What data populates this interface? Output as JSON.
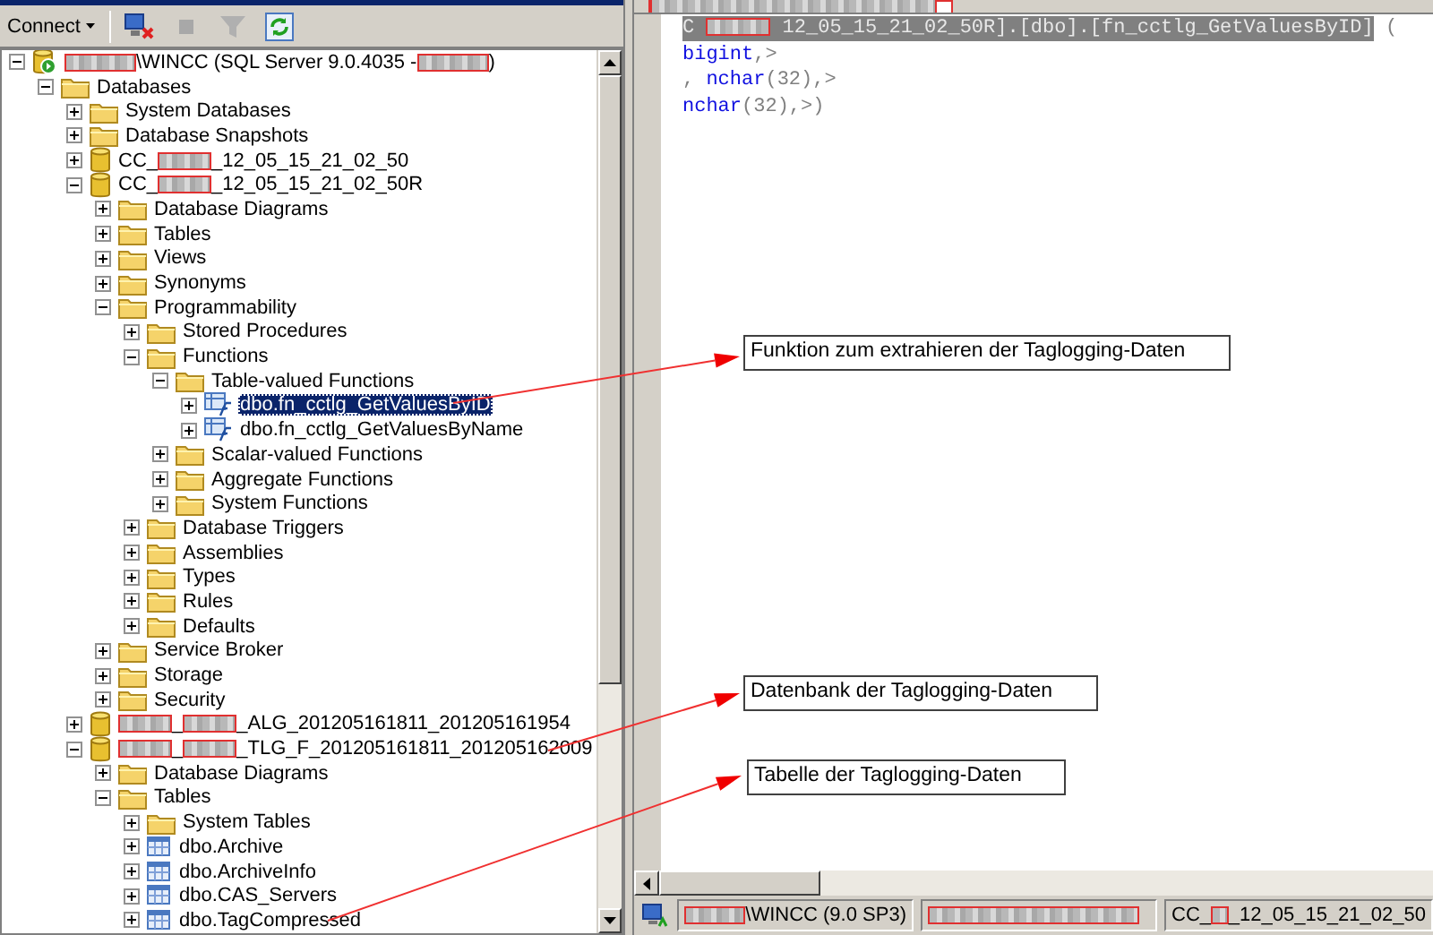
{
  "toolbar": {
    "connect_label": "Connect",
    "buttons": [
      {
        "kind": "disconnect",
        "disabled": false
      },
      {
        "kind": "stop",
        "disabled": true
      },
      {
        "kind": "filter",
        "disabled": true
      },
      {
        "kind": "refresh",
        "disabled": false
      }
    ]
  },
  "tree": [
    {
      "kind": "server",
      "expanded": true,
      "selected": false,
      "parts": [
        {
          "kind": "redacted"
        },
        {
          "kind": "text",
          "text": "\\WINCC (SQL Server 9.0.4035 - "
        },
        {
          "kind": "redacted"
        },
        {
          "kind": "text",
          "text": ")"
        }
      ],
      "children": [
        {
          "kind": "folder",
          "label": "Databases",
          "expanded": true,
          "selected": false,
          "children": [
            {
              "kind": "folder",
              "label": "System Databases",
              "expanded": false,
              "selected": false
            },
            {
              "kind": "folder",
              "label": "Database Snapshots",
              "expanded": false,
              "selected": false
            },
            {
              "kind": "database",
              "expanded": false,
              "selected": false,
              "parts": [
                {
                  "kind": "text",
                  "text": "CC_"
                },
                {
                  "kind": "redacted"
                },
                {
                  "kind": "text",
                  "text": "_12_05_15_21_02_50"
                }
              ]
            },
            {
              "kind": "database",
              "expanded": true,
              "selected": false,
              "parts": [
                {
                  "kind": "text",
                  "text": "CC_"
                },
                {
                  "kind": "redacted"
                },
                {
                  "kind": "text",
                  "text": "_12_05_15_21_02_50R"
                }
              ],
              "children": [
                {
                  "kind": "folder",
                  "label": "Database Diagrams",
                  "expanded": false,
                  "selected": false
                },
                {
                  "kind": "folder",
                  "label": "Tables",
                  "expanded": false,
                  "selected": false
                },
                {
                  "kind": "folder",
                  "label": "Views",
                  "expanded": false,
                  "selected": false
                },
                {
                  "kind": "folder",
                  "label": "Synonyms",
                  "expanded": false,
                  "selected": false
                },
                {
                  "kind": "folder",
                  "label": "Programmability",
                  "expanded": true,
                  "selected": false,
                  "children": [
                    {
                      "kind": "folder",
                      "label": "Stored Procedures",
                      "expanded": false,
                      "selected": false
                    },
                    {
                      "kind": "folder",
                      "label": "Functions",
                      "expanded": true,
                      "selected": false,
                      "children": [
                        {
                          "kind": "folder",
                          "label": "Table-valued Functions",
                          "expanded": true,
                          "selected": false,
                          "children": [
                            {
                              "kind": "function",
                              "label": "dbo.fn_cctlg_GetValuesByID",
                              "expanded": false,
                              "selected": true
                            },
                            {
                              "kind": "function",
                              "label": "dbo.fn_cctlg_GetValuesByName",
                              "expanded": false,
                              "selected": false
                            }
                          ]
                        },
                        {
                          "kind": "folder",
                          "label": "Scalar-valued Functions",
                          "expanded": false,
                          "selected": false
                        },
                        {
                          "kind": "folder",
                          "label": "Aggregate Functions",
                          "expanded": false,
                          "selected": false
                        },
                        {
                          "kind": "folder",
                          "label": "System Functions",
                          "expanded": false,
                          "selected": false
                        }
                      ]
                    },
                    {
                      "kind": "folder",
                      "label": "Database Triggers",
                      "expanded": false,
                      "selected": false
                    },
                    {
                      "kind": "folder",
                      "label": "Assemblies",
                      "expanded": false,
                      "selected": false
                    },
                    {
                      "kind": "folder",
                      "label": "Types",
                      "expanded": false,
                      "selected": false
                    },
                    {
                      "kind": "folder",
                      "label": "Rules",
                      "expanded": false,
                      "selected": false
                    },
                    {
                      "kind": "folder",
                      "label": "Defaults",
                      "expanded": false,
                      "selected": false
                    }
                  ]
                },
                {
                  "kind": "folder",
                  "label": "Service Broker",
                  "expanded": false,
                  "selected": false
                },
                {
                  "kind": "folder",
                  "label": "Storage",
                  "expanded": false,
                  "selected": false
                },
                {
                  "kind": "folder",
                  "label": "Security",
                  "expanded": false,
                  "selected": false
                }
              ]
            },
            {
              "kind": "database",
              "expanded": false,
              "selected": false,
              "parts": [
                {
                  "kind": "redacted"
                },
                {
                  "kind": "text",
                  "text": "_"
                },
                {
                  "kind": "redacted"
                },
                {
                  "kind": "text",
                  "text": "_ALG_201205161811_201205161954"
                }
              ]
            },
            {
              "kind": "database",
              "expanded": true,
              "selected": false,
              "parts": [
                {
                  "kind": "redacted"
                },
                {
                  "kind": "text",
                  "text": "_"
                },
                {
                  "kind": "redacted"
                },
                {
                  "kind": "text",
                  "text": "_TLG_F_201205161811_201205162009"
                }
              ],
              "children": [
                {
                  "kind": "folder",
                  "label": "Database Diagrams",
                  "expanded": false,
                  "selected": false
                },
                {
                  "kind": "folder",
                  "label": "Tables",
                  "expanded": true,
                  "selected": false,
                  "children": [
                    {
                      "kind": "folder",
                      "label": "System Tables",
                      "expanded": false,
                      "selected": false
                    },
                    {
                      "kind": "table",
                      "label": "dbo.Archive",
                      "expanded": false,
                      "selected": false
                    },
                    {
                      "kind": "table",
                      "label": "dbo.ArchiveInfo",
                      "expanded": false,
                      "selected": false
                    },
                    {
                      "kind": "table",
                      "label": "dbo.CAS_Servers",
                      "expanded": false,
                      "selected": false
                    },
                    {
                      "kind": "table",
                      "label": "dbo.TagCompressed",
                      "expanded": false,
                      "selected": false
                    }
                  ]
                }
              ]
            }
          ]
        }
      ]
    }
  ],
  "editor": {
    "tab": {
      "parts": [
        {
          "kind": "redacted"
        }
      ]
    },
    "lines": [
      [
        {
          "kind": "plain",
          "selected": true,
          "text": "C "
        },
        {
          "kind": "redacted",
          "selected": true
        },
        {
          "kind": "plain",
          "selected": true,
          "text": " 12_05_15_21_02_50R].[dbo].[fn_cctlg_GetValuesByID]"
        },
        {
          "kind": "punct",
          "selected": false,
          "text": " ("
        }
      ],
      [
        {
          "kind": "keyword",
          "selected": false,
          "text": "bigint"
        },
        {
          "kind": "punct",
          "selected": false,
          "text": ",>"
        }
      ],
      [
        {
          "kind": "punct",
          "selected": false,
          "text": ", "
        },
        {
          "kind": "keyword",
          "selected": false,
          "text": "nchar"
        },
        {
          "kind": "punct",
          "selected": false,
          "text": "(32),>"
        }
      ],
      [
        {
          "kind": "keyword",
          "selected": false,
          "text": "nchar"
        },
        {
          "kind": "punct",
          "selected": false,
          "text": "(32),>)"
        }
      ]
    ]
  },
  "callouts": [
    {
      "text": "Funktion zum extrahieren der Taglogging-Daten"
    },
    {
      "text": "Datenbank der Taglogging-Daten"
    },
    {
      "text": "Tabelle der Taglogging-Daten"
    }
  ],
  "status_bar": {
    "segments": [
      {
        "parts": [
          {
            "kind": "redacted"
          },
          {
            "kind": "text",
            "text": "\\WINCC (9.0 SP3)"
          }
        ]
      },
      {
        "parts": [
          {
            "kind": "redacted"
          }
        ]
      },
      {
        "parts": [
          {
            "kind": "text",
            "text": "CC_"
          },
          {
            "kind": "redacted"
          },
          {
            "kind": "text",
            "text": "_12_05_15_21_02_50"
          }
        ]
      }
    ]
  }
}
